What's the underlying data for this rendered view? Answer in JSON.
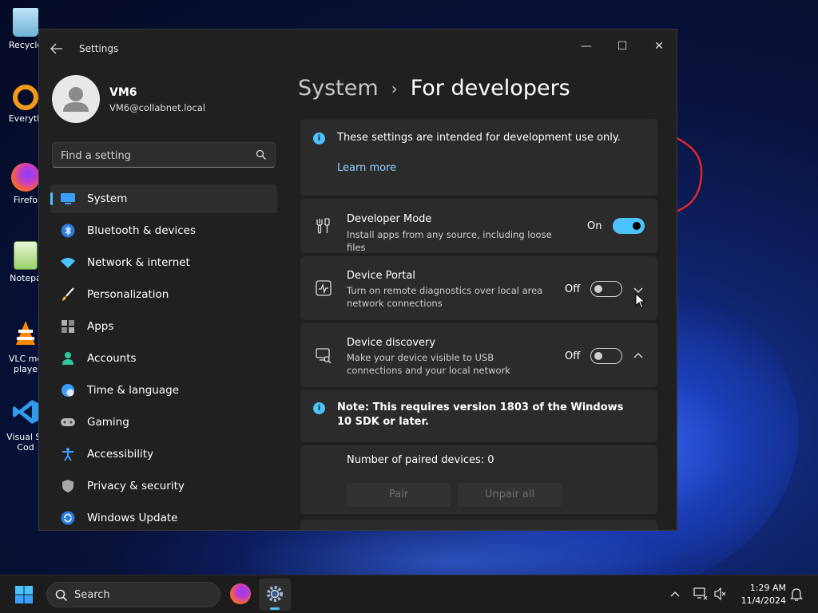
{
  "desktop": {
    "icons": [
      {
        "label": "Recycle",
        "icon": "recycle-bin-icon"
      },
      {
        "label": "Everyth",
        "icon": "everything-search-icon"
      },
      {
        "label": "Firefo",
        "icon": "firefox-icon"
      },
      {
        "label": "Notepa",
        "icon": "notepad-icon"
      },
      {
        "label": "VLC me",
        "label2": "playe",
        "icon": "vlc-icon"
      },
      {
        "label": "Visual St",
        "label2": "Cod",
        "icon": "vscode-icon"
      }
    ]
  },
  "window": {
    "title": "Settings",
    "controls": {
      "minimize": "—",
      "maximize": "☐",
      "close": "✕"
    }
  },
  "user": {
    "name": "VM6",
    "email": "VM6@collabnet.local"
  },
  "search": {
    "placeholder": "Find a setting"
  },
  "sidebar": {
    "items": [
      {
        "label": "System",
        "icon": "system-icon",
        "active": true
      },
      {
        "label": "Bluetooth & devices",
        "icon": "bluetooth-icon"
      },
      {
        "label": "Network & internet",
        "icon": "network-icon"
      },
      {
        "label": "Personalization",
        "icon": "brush-icon"
      },
      {
        "label": "Apps",
        "icon": "apps-icon"
      },
      {
        "label": "Accounts",
        "icon": "accounts-icon"
      },
      {
        "label": "Time & language",
        "icon": "globe-clock-icon"
      },
      {
        "label": "Gaming",
        "icon": "gamepad-icon"
      },
      {
        "label": "Accessibility",
        "icon": "accessibility-icon"
      },
      {
        "label": "Privacy & security",
        "icon": "shield-icon"
      },
      {
        "label": "Windows Update",
        "icon": "update-icon"
      }
    ]
  },
  "breadcrumb": {
    "parent": "System",
    "separator": "›",
    "current": "For developers"
  },
  "info": {
    "text": "These settings are intended for development use only.",
    "link": "Learn more"
  },
  "developer_mode": {
    "title": "Developer Mode",
    "description": "Install apps from any source, including loose files",
    "state": "On"
  },
  "device_portal": {
    "title": "Device Portal",
    "description": "Turn on remote diagnostics over local area network connections",
    "state": "Off"
  },
  "device_discovery": {
    "title": "Device discovery",
    "description": "Make your device visible to USB connections and your local network",
    "state": "Off",
    "note": "Note: This requires version 1803 of the Windows 10 SDK or later.",
    "paired_label": "Number of paired devices: 0",
    "pair_button": "Pair",
    "unpair_button": "Unpair all"
  },
  "taskbar": {
    "search_label": "Search",
    "time": "1:29 AM",
    "date": "11/4/2024"
  },
  "colors": {
    "accent": "#4cc2ff",
    "window_bg": "#202020",
    "card_bg": "#2b2b2b"
  }
}
